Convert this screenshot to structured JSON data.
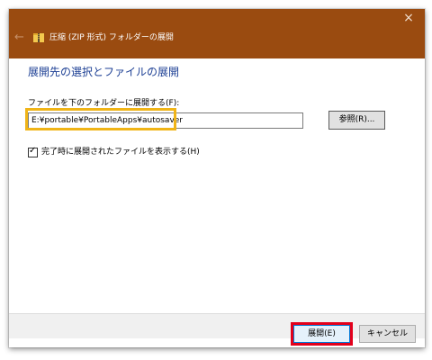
{
  "window": {
    "title": "圧縮 (ZIP 形式) フォルダーの展開",
    "close_glyph": "×",
    "back_glyph": "←",
    "accent_color": "#9a4b10"
  },
  "main": {
    "heading": "展開先の選択とファイルの展開",
    "field_label": "ファイルを下のフォルダーに展開する(F):",
    "path_value": "E:¥portable¥PortableApps¥autosaver",
    "browse_label": "参照(R)...",
    "checkbox_checked": true,
    "checkbox_label": "完了時に展開されたファイルを表示する(H)"
  },
  "footer": {
    "extract_label": "展開(E)",
    "cancel_label": "キャンセル"
  },
  "annotations": {
    "highlight_colors": [
      "#f0b417",
      "#e3001b"
    ]
  }
}
